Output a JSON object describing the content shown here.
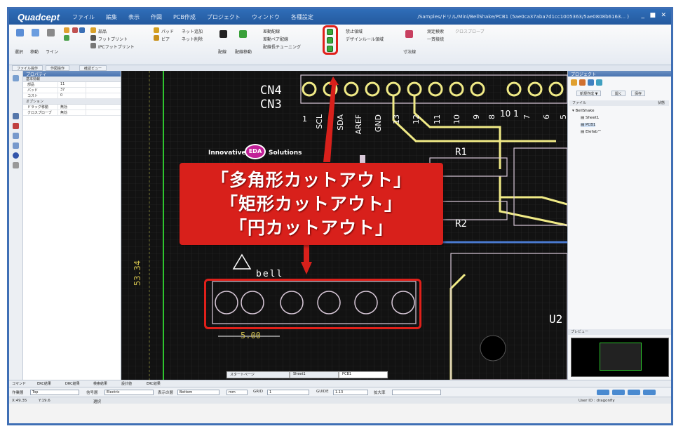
{
  "app": {
    "logo": "Quadcept",
    "menu": [
      "ファイル",
      "編集",
      "表示",
      "作図",
      "PCB作成",
      "プロジェクト",
      "ウィンドウ",
      "各種設定"
    ],
    "title_path": "/Samples/ドリル/Mini/BellShake/PCB1 (5ae0ca37aba7d1cc1005363/5ae0808b6163... )",
    "window_buttons": [
      "_",
      "■",
      "✕"
    ]
  },
  "ribbon": {
    "big_buttons": [
      "選択",
      "移動",
      "ライン"
    ],
    "group1": [
      "部品",
      "フットプリント",
      "IPCフットプリント"
    ],
    "group2": [
      "パッド",
      "ビア",
      "ネット追加",
      "ネット削除"
    ],
    "group3": [
      "配線",
      "配線移動"
    ],
    "group4": [
      "差動配線",
      "差動ペア配線",
      "配線長チューニング"
    ],
    "group5": [
      "禁止領域",
      "デザインルール領域"
    ],
    "group6": [
      "寸法線",
      "測定検索",
      "クロスプローブ",
      "一斉接続"
    ]
  },
  "left_tabs": [
    "ファイル操作",
    "作図操作",
    "確認ビュー"
  ],
  "properties": {
    "header": "プロパティ",
    "section_basic": "基本情報",
    "rows": [
      {
        "key": "部品",
        "value": "11"
      },
      {
        "key": "パッド",
        "value": "37"
      },
      {
        "key": "コスト",
        "value": "0"
      }
    ],
    "section_option": "オプション",
    "option_rows": [
      {
        "key": "ドラッグ移動",
        "value": "無効"
      },
      {
        "key": "クロスプローブ",
        "value": "無効"
      }
    ]
  },
  "pcb": {
    "labels": {
      "cn4": "CN4",
      "cn3": "CN3",
      "r1": "R1",
      "r2": "R2",
      "u2": "U2",
      "bell": "bell",
      "dim_vertical": "53.34",
      "dim_horizontal": "5.00",
      "brand_left": "Innovative",
      "brand_mid": "EDA",
      "brand_right": "Solutions"
    },
    "pin_labels": [
      "1",
      "SCL",
      "SDA",
      "AREF",
      "GND",
      "13",
      "12",
      "11",
      "10",
      "9",
      "8",
      "10 1",
      "7",
      "6",
      "5"
    ]
  },
  "callout": {
    "lines": [
      "「多角形カットアウト」",
      "「矩形カットアウト」",
      "「円カットアウト」"
    ]
  },
  "project_panel": {
    "header": "プロジェクト",
    "buttons": [
      "新規作成 ▼",
      "開く",
      "保存"
    ],
    "col_file": "ファイル",
    "col_state": "状態",
    "tree": [
      "BellShake",
      "Sheet1",
      "PCB1",
      "Elefab™"
    ],
    "preview_header": "プレビュー"
  },
  "bottom_tabs": [
    "コマンド",
    "ERC結果",
    "DRC結果",
    "検索結果",
    "設計値",
    "ERC結果"
  ],
  "doc_tabs": [
    "スタートページ",
    "Sheet1",
    "PCB1"
  ],
  "status": {
    "layer_label": "作業層",
    "layer_value": "Top",
    "net_label": "信号層",
    "net_value": "Electric",
    "disp_label": "表示の層",
    "disp_value": "Bottom",
    "unit_value": "mm",
    "grid_label": "GRID",
    "grid_value": "1",
    "guide_label": "GUIDE",
    "guide_value": "1.13",
    "zoom_label": "拡大率",
    "x_coord": "X:49.35",
    "y_coord": "Y:19.6",
    "mode": "選択",
    "user": "User ID : dragonfly"
  },
  "colors": {
    "accent": "#2f6db8",
    "callout": "#d8201b",
    "trace": "#f0ea86",
    "silk": "#ffffff",
    "grid": "#2a2a2a"
  }
}
